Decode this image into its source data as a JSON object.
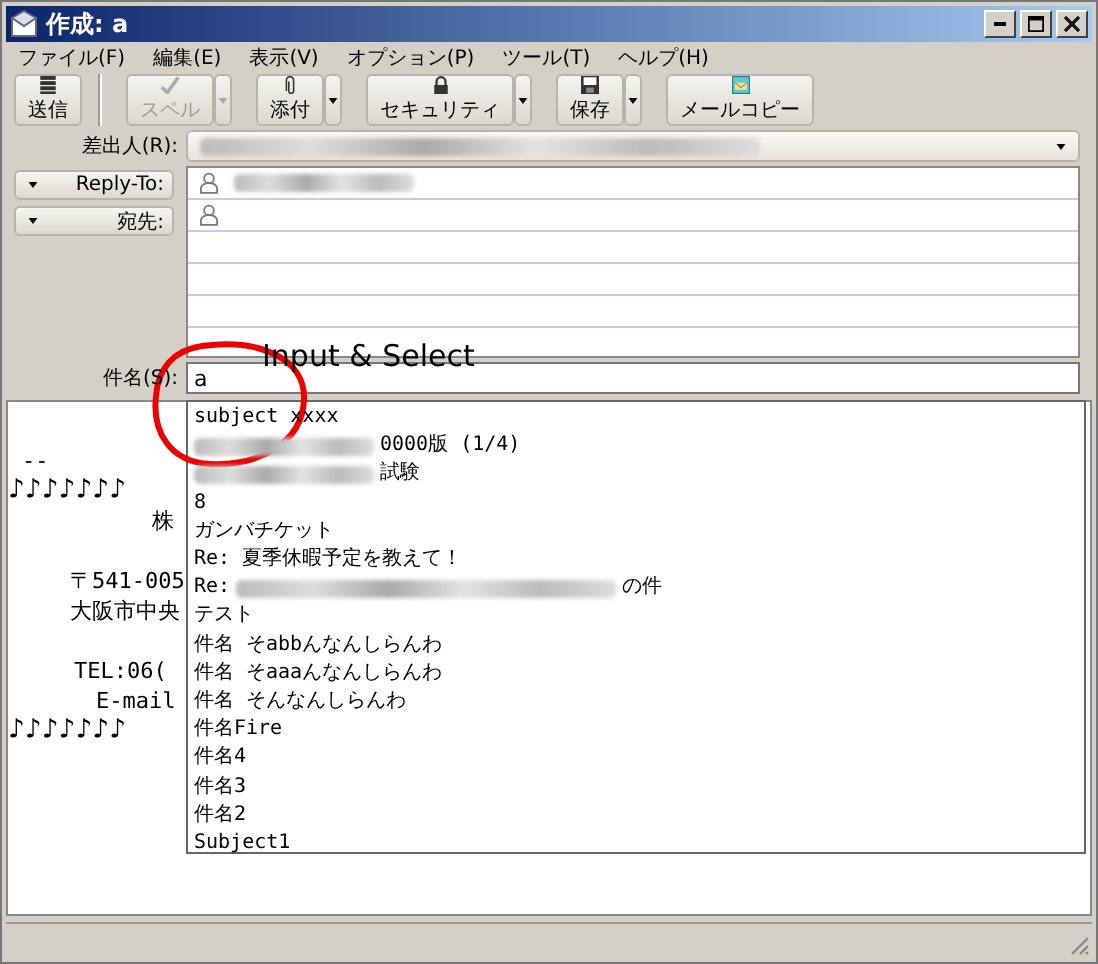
{
  "window": {
    "title": "作成: a"
  },
  "menu": [
    "ファイル(F)",
    "編集(E)",
    "表示(V)",
    "オプション(P)",
    "ツール(T)",
    "ヘルプ(H)"
  ],
  "toolbar": [
    {
      "label": "送信",
      "disabled": false,
      "dropdown": false
    },
    {
      "label": "スペル",
      "disabled": true,
      "dropdown": true
    },
    {
      "label": "添付",
      "disabled": false,
      "dropdown": true
    },
    {
      "label": "セキュリティ",
      "disabled": false,
      "dropdown": true
    },
    {
      "label": "保存",
      "disabled": false,
      "dropdown": true
    },
    {
      "label": "メールコピー",
      "disabled": false,
      "dropdown": false
    }
  ],
  "from": {
    "label": "差出人(R):",
    "redacted": true
  },
  "recipients": [
    {
      "type_label": "Reply-To:",
      "redacted": true
    },
    {
      "type_label": "宛先:",
      "redacted": false
    }
  ],
  "subject": {
    "label": "件名(S):",
    "value": "a"
  },
  "autocomplete": [
    {
      "text": "subject xxxx",
      "redacted": false
    },
    {
      "text": "0000版 (1/4)",
      "redacted": true
    },
    {
      "text": "試験",
      "redacted": true
    },
    {
      "text": "8",
      "redacted": false
    },
    {
      "text": "ガンバチケット",
      "redacted": false
    },
    {
      "text": "Re: 夏季休暇予定を教えて！",
      "redacted": false
    },
    {
      "prefix": "Re:",
      "text": "の件",
      "redacted": true
    },
    {
      "text": "テスト",
      "redacted": false
    },
    {
      "text": "件名 そabbんなんしらんわ",
      "redacted": false
    },
    {
      "text": "件名 そaaaんなんしらんわ",
      "redacted": false
    },
    {
      "text": "件名 そんなんしらんわ",
      "redacted": false
    },
    {
      "text": "件名Fire",
      "redacted": false
    },
    {
      "text": "件名4",
      "redacted": false
    },
    {
      "text": "件名3",
      "redacted": false
    },
    {
      "text": "件名2",
      "redacted": false
    },
    {
      "text": "Subject1",
      "redacted": false
    }
  ],
  "body": [
    [
      "--",
      "♪♪♪♪♪♪♪",
      "株"
    ],
    [
      "〒541-005",
      "大阪市中央"
    ],
    [
      "TEL:06(",
      "E-mail",
      "♪♪♪♪♪♪♪"
    ]
  ],
  "annotation": {
    "text": "Input & Select"
  }
}
